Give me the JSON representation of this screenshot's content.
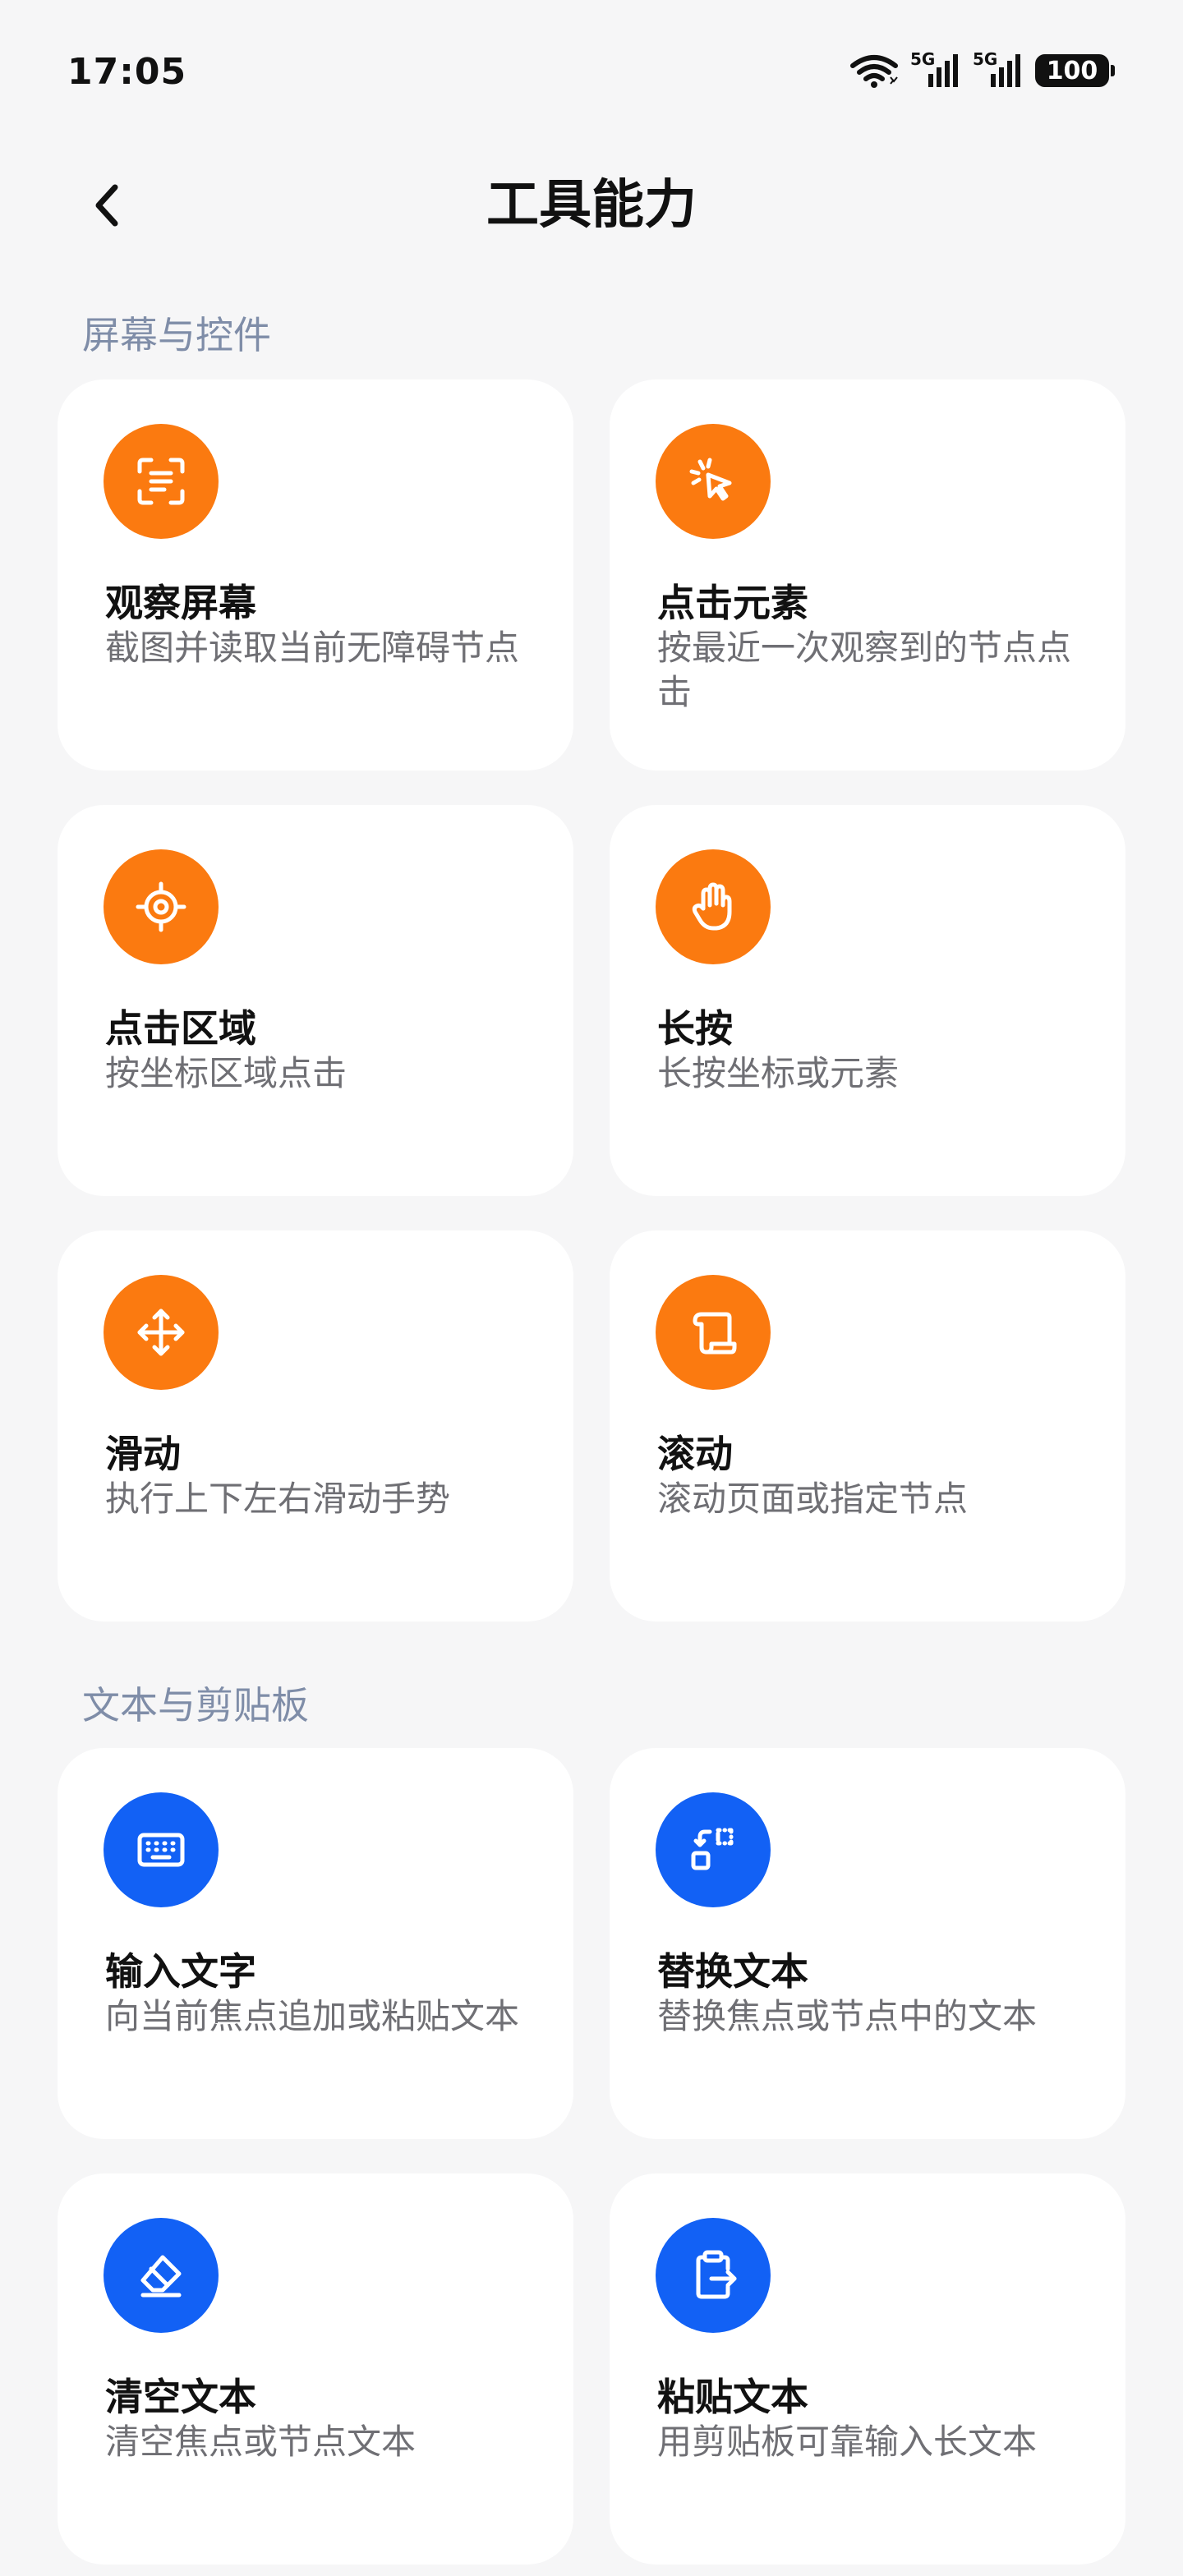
{
  "status_bar": {
    "time": "17:05",
    "network1": "5G",
    "network2": "5G",
    "battery": "100"
  },
  "header": {
    "title": "工具能力"
  },
  "sections": [
    {
      "title": "屏幕与控件",
      "items": [
        {
          "title": "观察屏幕",
          "desc": "截图并读取当前无障碍节点",
          "icon": "scan-text-icon",
          "color": "#fb7a10"
        },
        {
          "title": "点击元素",
          "desc": "按最近一次观察到的节点点击",
          "icon": "cursor-click-icon",
          "color": "#fb7a10"
        },
        {
          "title": "点击区域",
          "desc": "按坐标区域点击",
          "icon": "crosshair-icon",
          "color": "#fb7a10"
        },
        {
          "title": "长按",
          "desc": "长按坐标或元素",
          "icon": "hand-icon",
          "color": "#fb7a10"
        },
        {
          "title": "滑动",
          "desc": "执行上下左右滑动手势",
          "icon": "move-arrows-icon",
          "color": "#fb7a10"
        },
        {
          "title": "滚动",
          "desc": "滚动页面或指定节点",
          "icon": "scroll-icon",
          "color": "#fb7a10"
        }
      ]
    },
    {
      "title": "文本与剪贴板",
      "items": [
        {
          "title": "输入文字",
          "desc": "向当前焦点追加或粘贴文本",
          "icon": "keyboard-icon",
          "color": "#1261f5"
        },
        {
          "title": "替换文本",
          "desc": "替换焦点或节点中的文本",
          "icon": "replace-icon",
          "color": "#1261f5"
        },
        {
          "title": "清空文本",
          "desc": "清空焦点或节点文本",
          "icon": "eraser-icon",
          "color": "#1261f5"
        },
        {
          "title": "粘贴文本",
          "desc": "用剪贴板可靠输入长文本",
          "icon": "clipboard-paste-icon",
          "color": "#1261f5"
        }
      ]
    }
  ]
}
